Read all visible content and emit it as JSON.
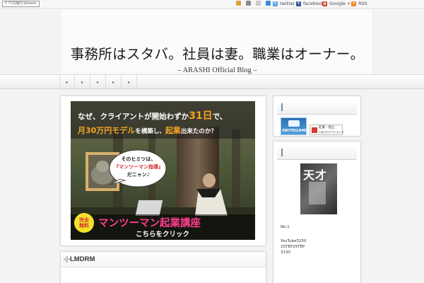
{
  "topbar": {
    "search_text": "ドア(同梱ち)Gmem",
    "social": {
      "twitter": "twitter",
      "facebook": "facebook",
      "google": "Google +1",
      "rss": "RSS"
    }
  },
  "header": {
    "title": "事務所はスタバ。社員は妻。職業はオーナー。",
    "subtitle": "– ARASHI Official Blog –"
  },
  "nav": {
    "items": [
      "▸",
      "▸",
      "▸",
      "▸",
      "▸"
    ]
  },
  "banner": {
    "line1_prefix": "なぜ、クライアントが開始わずか",
    "line1_num": "31日",
    "line1_suffix": "で、",
    "line2_hl1": "月30万円モデル",
    "line2_mid": "を構築し、",
    "line2_hl2": "起業",
    "line2_suffix": "出来たのか？",
    "bubble_line1": "そのヒミツは、",
    "bubble_line2": "『マンツーマン指導』",
    "bubble_line3": "だニャン♪",
    "badge": "完全無料",
    "course_title": "マンツーマン起業講座",
    "cta": "こちらをクリック"
  },
  "main": {
    "section_title": "LMDRM"
  },
  "sidebar": {
    "okitegami_label": "OKITEGAMI",
    "ranking_line1": "起業・独立",
    "ranking_line2": "人気ブログランキング",
    "book_label": "天才",
    "rank_text": "No.1",
    "line1": "YouTube3250",
    "line2": "2STEP2STEP",
    "line3": "3130"
  }
}
